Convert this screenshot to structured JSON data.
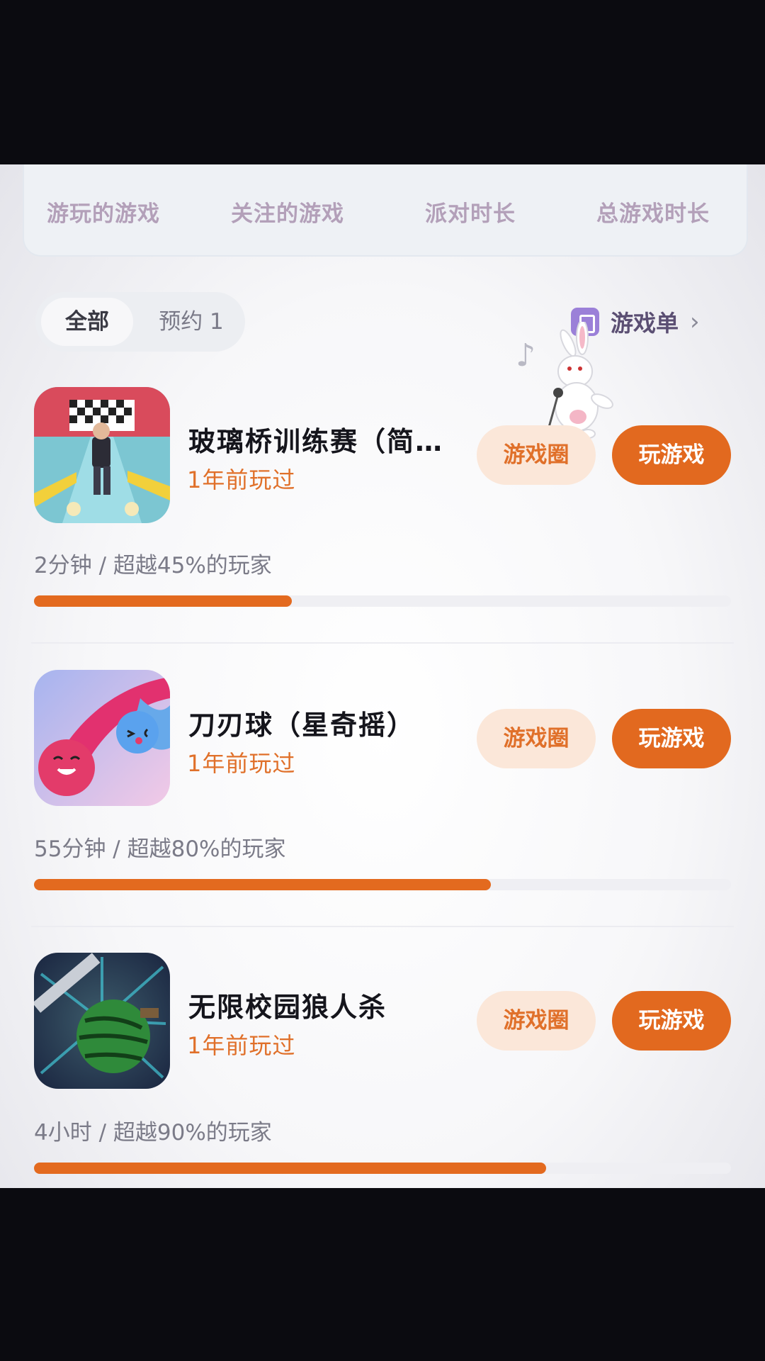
{
  "stats": {
    "labels": [
      "游玩的游戏",
      "关注的游戏",
      "派对时长",
      "总游戏时长"
    ]
  },
  "filters": {
    "all": "全部",
    "reserved": "预约 1",
    "game_list": "游戏单"
  },
  "colors": {
    "accent": "#e2691f",
    "accent_light": "#fbe7d9",
    "title": "#15151c"
  },
  "games": [
    {
      "title": "玻璃桥训练赛（简…",
      "last_played": "1年前玩过",
      "circle_label": "游戏圈",
      "play_label": "玩游戏",
      "stat": "2分钟 / 超越45%的玩家",
      "progress": 0.37,
      "icon": "glass-bridge-game-icon"
    },
    {
      "title": "刀刃球（星奇摇）",
      "last_played": "1年前玩过",
      "circle_label": "游戏圈",
      "play_label": "玩游戏",
      "stat": "55分钟 / 超越80%的玩家",
      "progress": 0.655,
      "icon": "blade-ball-game-icon"
    },
    {
      "title": "无限校园狼人杀",
      "last_played": "1年前玩过",
      "circle_label": "游戏圈",
      "play_label": "玩游戏",
      "stat": "4小时 / 超越90%的玩家",
      "progress": 0.735,
      "icon": "werewolf-watermelon-game-icon"
    }
  ]
}
